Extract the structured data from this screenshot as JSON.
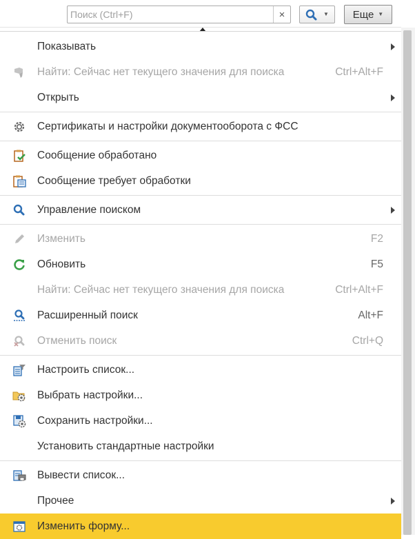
{
  "search": {
    "placeholder": "Поиск (Ctrl+F)",
    "value": "",
    "clear_label": "×"
  },
  "toolbar": {
    "more_label": "Еще"
  },
  "menu": {
    "items": [
      {
        "label": "Показывать",
        "shortcut": "",
        "submenu": true
      },
      {
        "label": "Найти: Сейчас нет текущего значения для поиска",
        "shortcut": "Ctrl+Alt+F",
        "disabled": true
      },
      {
        "label": "Открыть",
        "shortcut": "",
        "submenu": true
      },
      {
        "label": "Сертификаты и настройки документооборота с ФСС",
        "shortcut": ""
      },
      {
        "label": "Сообщение обработано",
        "shortcut": ""
      },
      {
        "label": "Сообщение требует обработки",
        "shortcut": ""
      },
      {
        "label": "Управление поиском",
        "shortcut": "",
        "submenu": true
      },
      {
        "label": "Изменить",
        "shortcut": "F2",
        "disabled": true
      },
      {
        "label": "Обновить",
        "shortcut": "F5"
      },
      {
        "label": "Найти: Сейчас нет текущего значения для поиска",
        "shortcut": "Ctrl+Alt+F",
        "disabled": true
      },
      {
        "label": "Расширенный поиск",
        "shortcut": "Alt+F"
      },
      {
        "label": "Отменить поиск",
        "shortcut": "Ctrl+Q",
        "disabled": true
      },
      {
        "label": "Настроить список...",
        "shortcut": ""
      },
      {
        "label": "Выбрать настройки...",
        "shortcut": ""
      },
      {
        "label": "Сохранить настройки...",
        "shortcut": ""
      },
      {
        "label": "Установить стандартные настройки",
        "shortcut": ""
      },
      {
        "label": "Вывести список...",
        "shortcut": ""
      },
      {
        "label": "Прочее",
        "shortcut": "",
        "submenu": true
      },
      {
        "label": "Изменить форму...",
        "shortcut": "",
        "highlighted": true
      }
    ]
  },
  "colors": {
    "highlight": "#f8cb2e",
    "accent_blue": "#2e6fb5",
    "accent_green": "#3aa048"
  }
}
